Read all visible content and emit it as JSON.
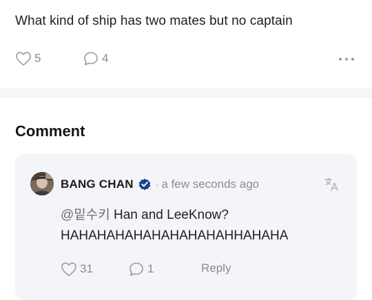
{
  "post": {
    "text": "What kind of ship has two mates but no captain",
    "like_count": "5",
    "comment_count": "4"
  },
  "comments_section": {
    "heading": "Comment"
  },
  "comment": {
    "author": "BANG CHAN",
    "separator": "·",
    "timestamp": "a few seconds ago",
    "mention": "@밑수키",
    "line1": " Han and LeeKnow?",
    "line2": "HAHAHAHAHAHAHAHAHAHHAHAHA",
    "like_count": "31",
    "reply_count": "1",
    "reply_label": "Reply"
  },
  "colors": {
    "verified_badge": "#1d3f8f",
    "muted_text": "#8a8a8a",
    "card_bg": "#f4f5f8"
  },
  "icons": [
    "heart-icon",
    "comment-bubble-icon",
    "more-dots-icon",
    "verified-badge-icon",
    "translate-icon"
  ]
}
